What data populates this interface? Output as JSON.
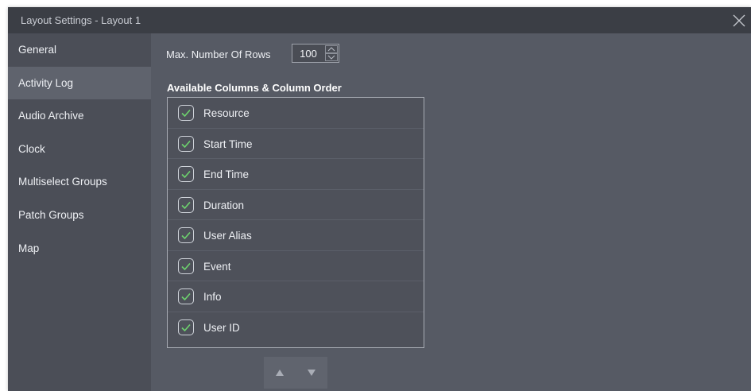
{
  "window": {
    "title": "Layout Settings - Layout 1"
  },
  "sidebar": {
    "items": [
      {
        "label": "General",
        "active": false
      },
      {
        "label": "Activity Log",
        "active": true
      },
      {
        "label": "Audio Archive",
        "active": false
      },
      {
        "label": "Clock",
        "active": false
      },
      {
        "label": "Multiselect Groups",
        "active": false
      },
      {
        "label": "Patch Groups",
        "active": false
      },
      {
        "label": "Map",
        "active": false
      }
    ]
  },
  "settings": {
    "max_rows_label": "Max. Number Of Rows",
    "max_rows_value": "100",
    "columns_title": "Available Columns & Column Order",
    "columns": [
      {
        "label": "Resource",
        "checked": true
      },
      {
        "label": "Start Time",
        "checked": true
      },
      {
        "label": "End Time",
        "checked": true
      },
      {
        "label": "Duration",
        "checked": true
      },
      {
        "label": "User Alias",
        "checked": true
      },
      {
        "label": "Event",
        "checked": true
      },
      {
        "label": "Info",
        "checked": true
      },
      {
        "label": "User ID",
        "checked": true
      }
    ]
  },
  "icons": {
    "close": "close-icon",
    "check": "check-icon",
    "move_up": "arrow-up-icon",
    "move_down": "arrow-down-icon"
  },
  "colors": {
    "check_green": "#6ed46e",
    "window_bg": "#565a64",
    "sidebar_bg": "#4b4e57",
    "titlebar_bg": "#3b3e45",
    "active_item_bg": "#5f636d"
  }
}
